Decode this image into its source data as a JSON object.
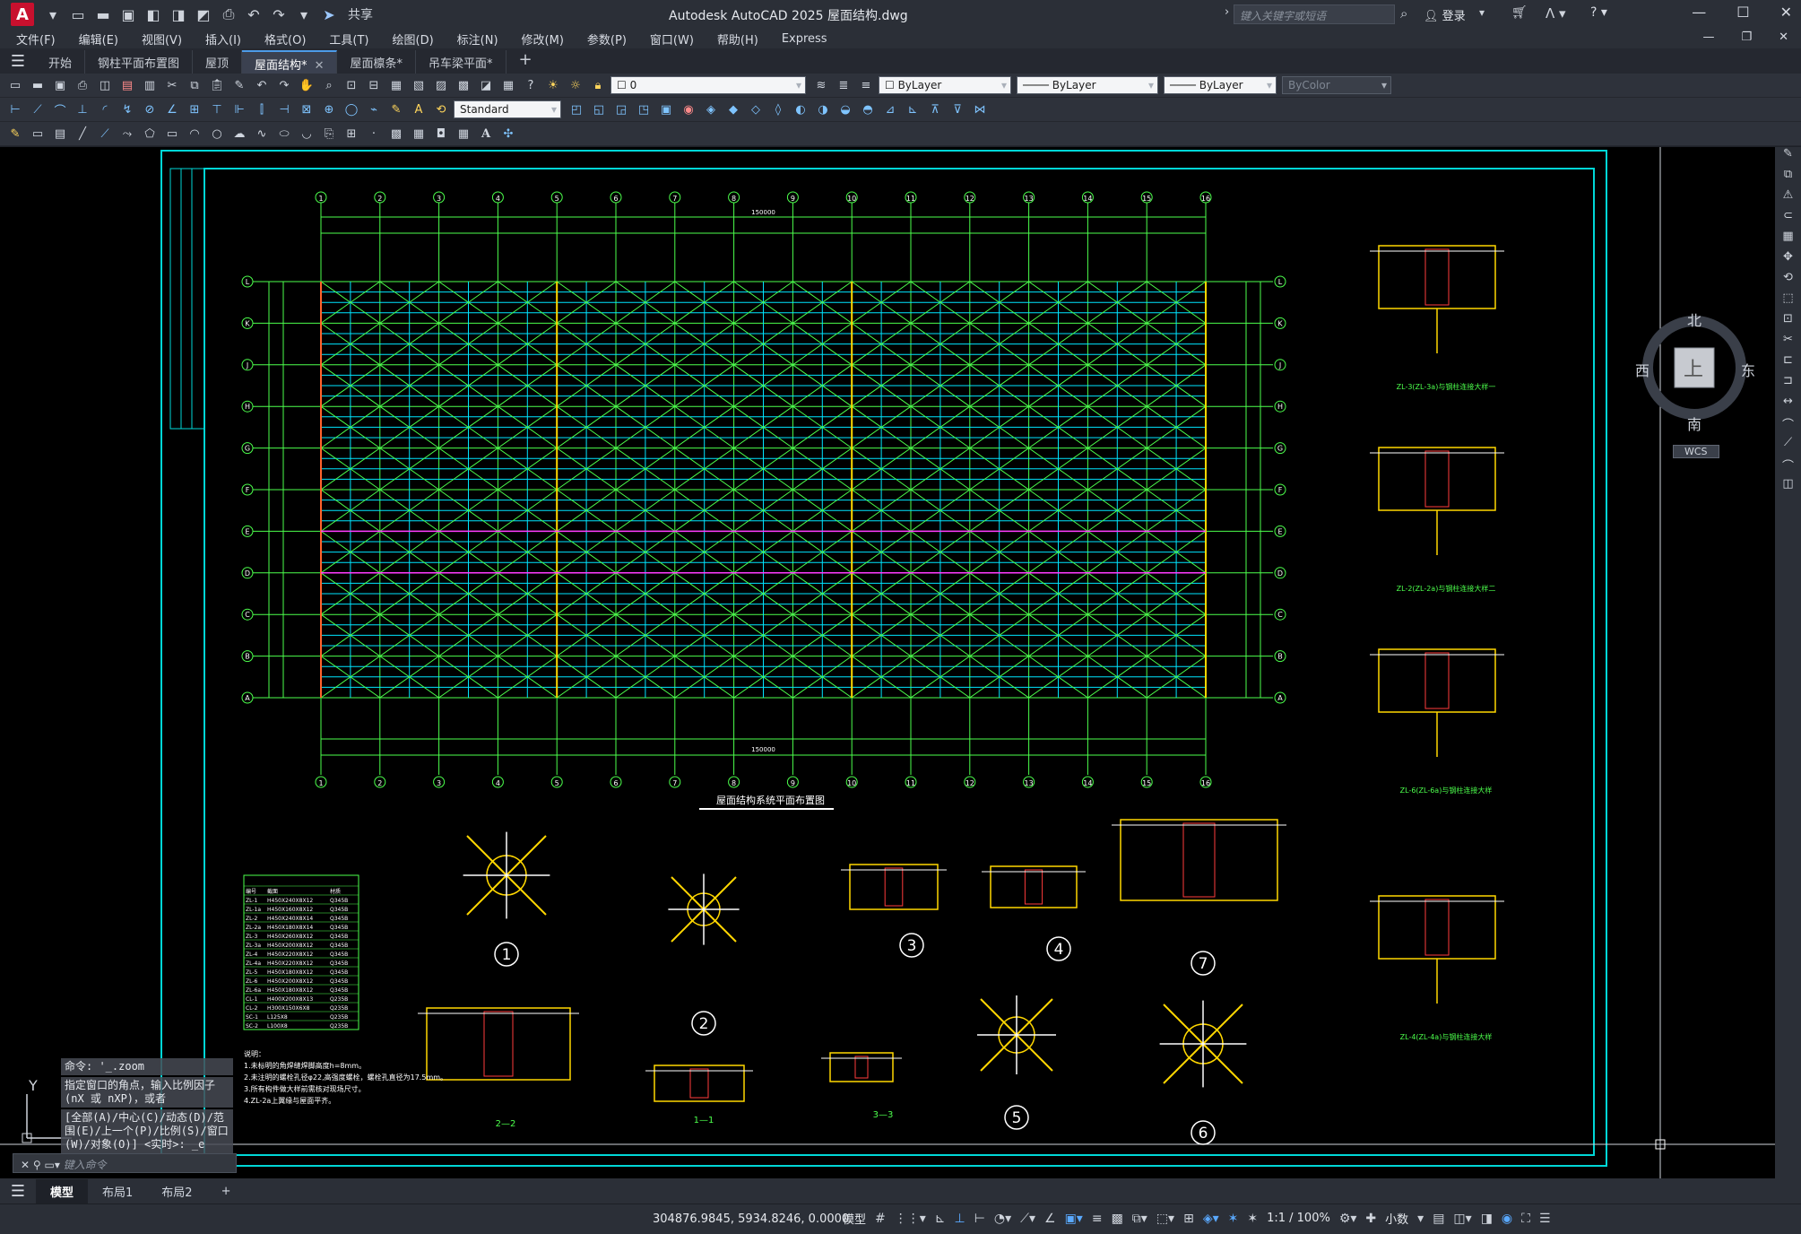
{
  "titlebar": {
    "logo": "A",
    "share_label": "共享",
    "title": "Autodesk AutoCAD 2025    屋面结构.dwg",
    "search_placeholder": "键入关键字或短语",
    "login_label": "登录"
  },
  "menu": [
    "文件(F)",
    "编辑(E)",
    "视图(V)",
    "插入(I)",
    "格式(O)",
    "工具(T)",
    "绘图(D)",
    "标注(N)",
    "修改(M)",
    "参数(P)",
    "窗口(W)",
    "帮助(H)",
    "Express"
  ],
  "file_tabs": [
    {
      "label": "开始",
      "active": false,
      "closable": false
    },
    {
      "label": "钢柱平面布置图",
      "active": false,
      "closable": false
    },
    {
      "label": "屋顶",
      "active": false,
      "closable": false
    },
    {
      "label": "屋面结构*",
      "active": true,
      "closable": true
    },
    {
      "label": "屋面檩条*",
      "active": false,
      "closable": false
    },
    {
      "label": "吊车梁平面*",
      "active": false,
      "closable": false
    }
  ],
  "properties": {
    "layer": "0",
    "color": "ByLayer",
    "linetype": "ByLayer",
    "lineweight": "ByLayer",
    "plotstyle": "ByColor",
    "text_style": "Standard"
  },
  "drawing": {
    "plan_title": "屋面结构系统平面布置图",
    "grid_cols": [
      "1",
      "2",
      "3",
      "4",
      "5",
      "6",
      "7",
      "8",
      "9",
      "10",
      "11",
      "12",
      "13",
      "14",
      "15",
      "16"
    ],
    "grid_rows": [
      "L",
      "K",
      "J",
      "H",
      "G",
      "F",
      "E",
      "D",
      "C",
      "B",
      "A"
    ],
    "total_width": "150000",
    "section_labels": [
      "1",
      "2",
      "3",
      "4",
      "5",
      "6",
      "7"
    ],
    "section_names": [
      "2—2",
      "1—1",
      "3—3"
    ],
    "detail_titles": [
      "ZL-3(ZL-3a)与钢柱连接大样一",
      "ZL-2(ZL-2a)与钢柱连接大样二",
      "ZL-6(ZL-6a)与钢柱连接大样",
      "ZL-4(ZL-4a)与钢柱连接大样"
    ],
    "member_table": {
      "header": [
        "编号",
        "截面",
        "材质"
      ],
      "rows": [
        [
          "ZL-1",
          "H450X240X8X12",
          "Q345B"
        ],
        [
          "ZL-1a",
          "H450X160X8X12",
          "Q345B"
        ],
        [
          "ZL-2",
          "H450X240X8X14",
          "Q345B"
        ],
        [
          "ZL-2a",
          "H450X180X8X14",
          "Q345B"
        ],
        [
          "ZL-3",
          "H450X260X8X12",
          "Q345B"
        ],
        [
          "ZL-3a",
          "H450X200X8X12",
          "Q345B"
        ],
        [
          "ZL-4",
          "H450X220X8X12",
          "Q345B"
        ],
        [
          "ZL-4a",
          "H450X220X8X12",
          "Q345B"
        ],
        [
          "ZL-5",
          "H450X180X8X12",
          "Q345B"
        ],
        [
          "ZL-6",
          "H450X200X8X12",
          "Q345B"
        ],
        [
          "ZL-6a",
          "H450X180X8X12",
          "Q345B"
        ],
        [
          "CL-1",
          "H400X200X8X13",
          "Q235B"
        ],
        [
          "CL-2",
          "H300X150X6X8",
          "Q235B"
        ],
        [
          "SC-1",
          "L125X8",
          "Q235B"
        ],
        [
          "SC-2",
          "L100X8",
          "Q235B"
        ]
      ]
    },
    "notes": [
      "说明：",
      "1.未标明的角焊缝焊脚高度h=8mm。",
      "2.未注明的螺栓孔径φ22,高强度螺栓，螺栓孔直径为17.5mm。",
      "3.所有构件做大样前需核对现场尺寸。",
      "4.ZL-2a上翼缘与屋面平齐。"
    ]
  },
  "viewcube": {
    "north": "北",
    "south": "南",
    "east": "东",
    "west": "西",
    "face": "上",
    "wcs": "WCS"
  },
  "command": {
    "history": [
      "命令: '_.zoom",
      "指定窗口的角点，输入比例因子 (nX 或 nXP)，或者",
      "[全部(A)/中心(C)/动态(D)/范围(E)/上一个(P)/比例(S)/窗口(W)/对象(O)] <实时>: _e"
    ],
    "input_placeholder": "键入命令"
  },
  "layout_tabs": [
    {
      "label": "模型",
      "active": true
    },
    {
      "label": "布局1",
      "active": false
    },
    {
      "label": "布局2",
      "active": false
    }
  ],
  "status": {
    "coords": "304876.9845, 5934.8246, 0.0000",
    "model": "模型",
    "scale": "1:1 / 100%",
    "units": "小数"
  }
}
